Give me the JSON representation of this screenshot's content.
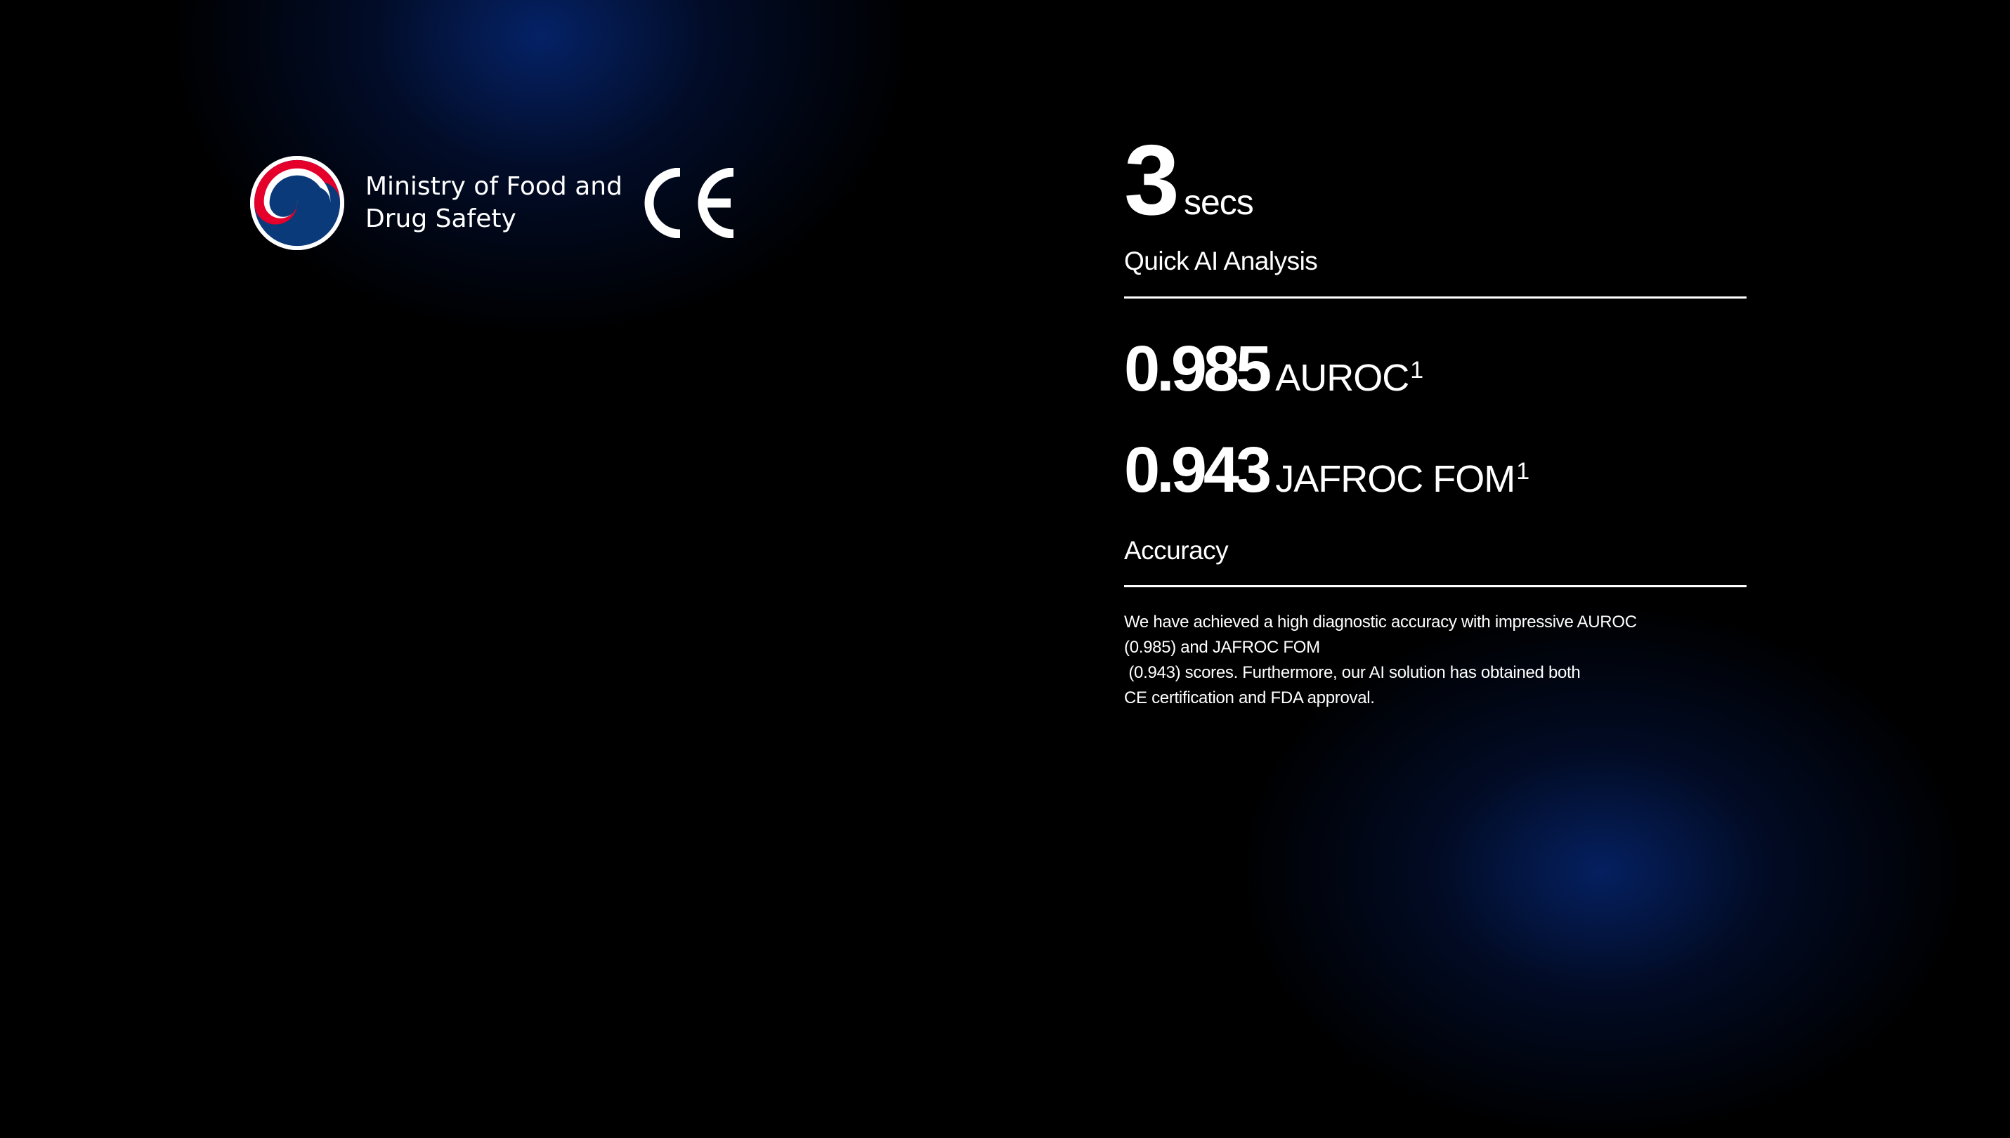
{
  "colors": {
    "background": "#000000",
    "glow": "#062878",
    "text": "#ffffff",
    "emblem_red": "#e4002b",
    "emblem_blue": "#0a3a7a"
  },
  "certifications": {
    "emblem_icon": "mfds-taegeuk-emblem",
    "ministry_name_lines": [
      "Ministry of Food and",
      "Drug Safety"
    ],
    "ce_icon": "ce-mark"
  },
  "stats": {
    "speed": {
      "value": "3",
      "unit": "secs"
    },
    "speed_label": "Quick AI Analysis",
    "auroc": {
      "value": "0.985",
      "unit": "AUROC",
      "footnote": "1"
    },
    "jafroc": {
      "value": "0.943",
      "unit": "JAFROC FOM",
      "footnote": "1"
    },
    "accuracy_label": "Accuracy",
    "description_lines": [
      "We have achieved a high diagnostic accuracy with impressive AUROC",
      "(0.985) and JAFROC FOM",
      " (0.943) scores. Furthermore, our AI solution has obtained both",
      "CE certification and FDA approval."
    ]
  }
}
